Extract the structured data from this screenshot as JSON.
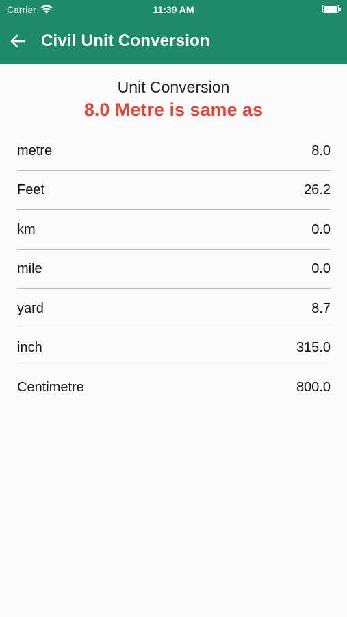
{
  "status_bar": {
    "carrier": "Carrier",
    "time": "11:39 AM",
    "battery_level": 1.0
  },
  "appbar": {
    "back_icon": "arrow-left-icon",
    "title": "Civil Unit Conversion"
  },
  "main": {
    "subtitle": "Unit Conversion",
    "headline": "8.0 Metre is same as",
    "rows": [
      {
        "unit": "metre",
        "value": "8.0"
      },
      {
        "unit": "Feet",
        "value": "26.2"
      },
      {
        "unit": "km",
        "value": "0.0"
      },
      {
        "unit": "mile",
        "value": "0.0"
      },
      {
        "unit": "yard",
        "value": "8.7"
      },
      {
        "unit": "inch",
        "value": "315.0"
      },
      {
        "unit": "Centimetre",
        "value": "800.0"
      }
    ]
  },
  "colors": {
    "header": "#1e8a6a",
    "headline": "#e0453b",
    "background": "#fafafa"
  }
}
